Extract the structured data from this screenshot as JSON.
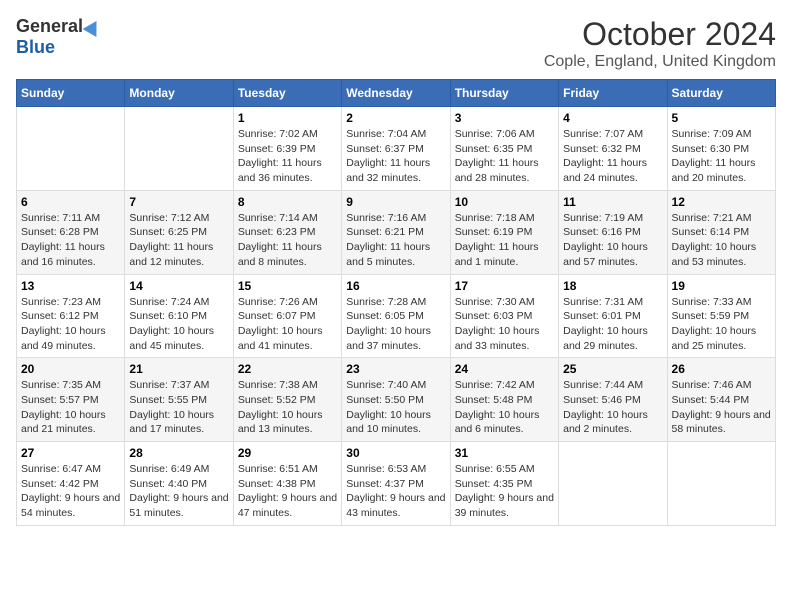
{
  "header": {
    "logo_general": "General",
    "logo_blue": "Blue",
    "month_title": "October 2024",
    "location": "Cople, England, United Kingdom"
  },
  "days_of_week": [
    "Sunday",
    "Monday",
    "Tuesday",
    "Wednesday",
    "Thursday",
    "Friday",
    "Saturday"
  ],
  "weeks": [
    [
      {
        "day": "",
        "info": ""
      },
      {
        "day": "",
        "info": ""
      },
      {
        "day": "1",
        "info": "Sunrise: 7:02 AM\nSunset: 6:39 PM\nDaylight: 11 hours and 36 minutes."
      },
      {
        "day": "2",
        "info": "Sunrise: 7:04 AM\nSunset: 6:37 PM\nDaylight: 11 hours and 32 minutes."
      },
      {
        "day": "3",
        "info": "Sunrise: 7:06 AM\nSunset: 6:35 PM\nDaylight: 11 hours and 28 minutes."
      },
      {
        "day": "4",
        "info": "Sunrise: 7:07 AM\nSunset: 6:32 PM\nDaylight: 11 hours and 24 minutes."
      },
      {
        "day": "5",
        "info": "Sunrise: 7:09 AM\nSunset: 6:30 PM\nDaylight: 11 hours and 20 minutes."
      }
    ],
    [
      {
        "day": "6",
        "info": "Sunrise: 7:11 AM\nSunset: 6:28 PM\nDaylight: 11 hours and 16 minutes."
      },
      {
        "day": "7",
        "info": "Sunrise: 7:12 AM\nSunset: 6:25 PM\nDaylight: 11 hours and 12 minutes."
      },
      {
        "day": "8",
        "info": "Sunrise: 7:14 AM\nSunset: 6:23 PM\nDaylight: 11 hours and 8 minutes."
      },
      {
        "day": "9",
        "info": "Sunrise: 7:16 AM\nSunset: 6:21 PM\nDaylight: 11 hours and 5 minutes."
      },
      {
        "day": "10",
        "info": "Sunrise: 7:18 AM\nSunset: 6:19 PM\nDaylight: 11 hours and 1 minute."
      },
      {
        "day": "11",
        "info": "Sunrise: 7:19 AM\nSunset: 6:16 PM\nDaylight: 10 hours and 57 minutes."
      },
      {
        "day": "12",
        "info": "Sunrise: 7:21 AM\nSunset: 6:14 PM\nDaylight: 10 hours and 53 minutes."
      }
    ],
    [
      {
        "day": "13",
        "info": "Sunrise: 7:23 AM\nSunset: 6:12 PM\nDaylight: 10 hours and 49 minutes."
      },
      {
        "day": "14",
        "info": "Sunrise: 7:24 AM\nSunset: 6:10 PM\nDaylight: 10 hours and 45 minutes."
      },
      {
        "day": "15",
        "info": "Sunrise: 7:26 AM\nSunset: 6:07 PM\nDaylight: 10 hours and 41 minutes."
      },
      {
        "day": "16",
        "info": "Sunrise: 7:28 AM\nSunset: 6:05 PM\nDaylight: 10 hours and 37 minutes."
      },
      {
        "day": "17",
        "info": "Sunrise: 7:30 AM\nSunset: 6:03 PM\nDaylight: 10 hours and 33 minutes."
      },
      {
        "day": "18",
        "info": "Sunrise: 7:31 AM\nSunset: 6:01 PM\nDaylight: 10 hours and 29 minutes."
      },
      {
        "day": "19",
        "info": "Sunrise: 7:33 AM\nSunset: 5:59 PM\nDaylight: 10 hours and 25 minutes."
      }
    ],
    [
      {
        "day": "20",
        "info": "Sunrise: 7:35 AM\nSunset: 5:57 PM\nDaylight: 10 hours and 21 minutes."
      },
      {
        "day": "21",
        "info": "Sunrise: 7:37 AM\nSunset: 5:55 PM\nDaylight: 10 hours and 17 minutes."
      },
      {
        "day": "22",
        "info": "Sunrise: 7:38 AM\nSunset: 5:52 PM\nDaylight: 10 hours and 13 minutes."
      },
      {
        "day": "23",
        "info": "Sunrise: 7:40 AM\nSunset: 5:50 PM\nDaylight: 10 hours and 10 minutes."
      },
      {
        "day": "24",
        "info": "Sunrise: 7:42 AM\nSunset: 5:48 PM\nDaylight: 10 hours and 6 minutes."
      },
      {
        "day": "25",
        "info": "Sunrise: 7:44 AM\nSunset: 5:46 PM\nDaylight: 10 hours and 2 minutes."
      },
      {
        "day": "26",
        "info": "Sunrise: 7:46 AM\nSunset: 5:44 PM\nDaylight: 9 hours and 58 minutes."
      }
    ],
    [
      {
        "day": "27",
        "info": "Sunrise: 6:47 AM\nSunset: 4:42 PM\nDaylight: 9 hours and 54 minutes."
      },
      {
        "day": "28",
        "info": "Sunrise: 6:49 AM\nSunset: 4:40 PM\nDaylight: 9 hours and 51 minutes."
      },
      {
        "day": "29",
        "info": "Sunrise: 6:51 AM\nSunset: 4:38 PM\nDaylight: 9 hours and 47 minutes."
      },
      {
        "day": "30",
        "info": "Sunrise: 6:53 AM\nSunset: 4:37 PM\nDaylight: 9 hours and 43 minutes."
      },
      {
        "day": "31",
        "info": "Sunrise: 6:55 AM\nSunset: 4:35 PM\nDaylight: 9 hours and 39 minutes."
      },
      {
        "day": "",
        "info": ""
      },
      {
        "day": "",
        "info": ""
      }
    ]
  ]
}
